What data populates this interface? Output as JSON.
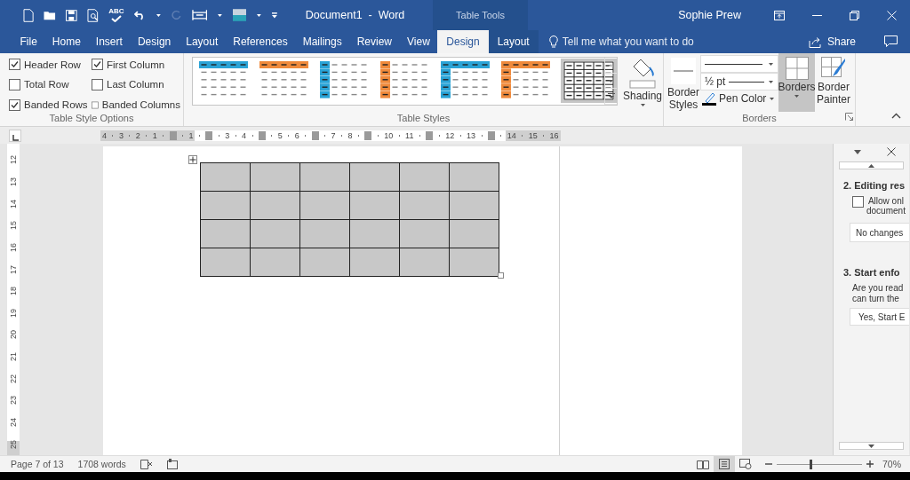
{
  "title_bar": {
    "spelling_icon_text": "ABC",
    "document_title": "Document1  -  Word",
    "contextual_label": "Table Tools",
    "user": "Sophie Prew"
  },
  "tabs": [
    {
      "label": "File",
      "selected": false,
      "contextual": false
    },
    {
      "label": "Home",
      "selected": false,
      "contextual": false
    },
    {
      "label": "Insert",
      "selected": false,
      "contextual": false
    },
    {
      "label": "Design",
      "selected": false,
      "contextual": false
    },
    {
      "label": "Layout",
      "selected": false,
      "contextual": false
    },
    {
      "label": "References",
      "selected": false,
      "contextual": false
    },
    {
      "label": "Mailings",
      "selected": false,
      "contextual": false
    },
    {
      "label": "Review",
      "selected": false,
      "contextual": false
    },
    {
      "label": "View",
      "selected": false,
      "contextual": false
    },
    {
      "label": "Design",
      "selected": true,
      "contextual": true
    },
    {
      "label": "Layout",
      "selected": false,
      "contextual": true
    }
  ],
  "tell_me": {
    "placeholder": "Tell me what you want to do"
  },
  "share": "Share",
  "ribbon": {
    "table_style_options": {
      "label": "Table Style Options",
      "options": [
        {
          "label": "Header Row",
          "checked": true
        },
        {
          "label": "First Column",
          "checked": true
        },
        {
          "label": "Total Row",
          "checked": false
        },
        {
          "label": "Last Column",
          "checked": false
        },
        {
          "label": "Banded Rows",
          "checked": true
        },
        {
          "label": "Banded Columns",
          "checked": false
        }
      ]
    },
    "table_styles": {
      "label": "Table Styles",
      "styles": [
        {
          "kind": "header_row",
          "color": "#2aa3d6",
          "selected": false
        },
        {
          "kind": "header_row",
          "color": "#ef8a3c",
          "selected": false
        },
        {
          "kind": "first_column",
          "color": "#2aa3d6",
          "selected": false
        },
        {
          "kind": "first_column",
          "color": "#ef8a3c",
          "selected": false
        },
        {
          "kind": "header_first",
          "color": "#2aa3d6",
          "selected": false
        },
        {
          "kind": "header_first",
          "color": "#ef8a3c",
          "selected": false
        },
        {
          "kind": "grid",
          "selected": true
        }
      ],
      "shading": "Shading"
    },
    "borders": {
      "label": "Borders",
      "border_styles": "Border Styles",
      "pen_weight": "½ pt",
      "pen_color": "Pen Color",
      "borders_button": {
        "label": "Borders",
        "pressed": true
      },
      "border_painter": "Border Painter"
    }
  },
  "ruler": {
    "horizontal": [
      {
        "kind": "label",
        "text": "4"
      },
      {
        "kind": "label",
        "text": "3"
      },
      {
        "kind": "label",
        "text": "2"
      },
      {
        "kind": "label",
        "text": "1"
      },
      {
        "kind": "marker"
      },
      {
        "kind": "label",
        "text": "1"
      },
      {
        "kind": "marker"
      },
      {
        "kind": "label",
        "text": "3"
      },
      {
        "kind": "label",
        "text": "4"
      },
      {
        "kind": "marker"
      },
      {
        "kind": "label",
        "text": "5"
      },
      {
        "kind": "label",
        "text": "6"
      },
      {
        "kind": "marker"
      },
      {
        "kind": "label",
        "text": "7"
      },
      {
        "kind": "label",
        "text": "8"
      },
      {
        "kind": "marker"
      },
      {
        "kind": "label",
        "text": "10"
      },
      {
        "kind": "label",
        "text": "11"
      },
      {
        "kind": "marker"
      },
      {
        "kind": "label",
        "text": "12"
      },
      {
        "kind": "label",
        "text": "13"
      },
      {
        "kind": "marker"
      },
      {
        "kind": "label",
        "text": "14"
      },
      {
        "kind": "label",
        "text": "15"
      },
      {
        "kind": "label",
        "text": "16"
      }
    ],
    "vertical": [
      "12",
      "13",
      "14",
      "15",
      "16",
      "17",
      "18",
      "19",
      "20",
      "21",
      "22",
      "23",
      "24",
      "25"
    ]
  },
  "document": {
    "table": {
      "rows": [
        {
          "cells": [
            {
              "shaded": true
            },
            {
              "shaded": true
            },
            {
              "shaded": true
            },
            {
              "shaded": true
            },
            {
              "shaded": true
            },
            {
              "shaded": true
            }
          ]
        },
        {
          "cells": [
            {
              "shaded": true
            },
            {
              "shaded": true
            },
            {
              "shaded": true
            },
            {
              "shaded": true
            },
            {
              "shaded": true
            },
            {
              "shaded": true
            }
          ]
        },
        {
          "cells": [
            {
              "shaded": true
            },
            {
              "shaded": true
            },
            {
              "shaded": true
            },
            {
              "shaded": true
            },
            {
              "shaded": true
            },
            {
              "shaded": true
            }
          ]
        },
        {
          "cells": [
            {
              "shaded": true
            },
            {
              "shaded": true
            },
            {
              "shaded": true
            },
            {
              "shaded": true
            },
            {
              "shaded": true
            },
            {
              "shaded": true
            }
          ]
        }
      ]
    }
  },
  "restrict_editing_pane": {
    "section_2_heading": "2. Editing res",
    "allow_only": {
      "lines": [
        "Allow onl",
        "document"
      ],
      "checked": false
    },
    "restriction_value": "No changes",
    "section_3_heading": "3. Start enfo",
    "question_lines": [
      "Are you read",
      "can turn the"
    ],
    "start_button": "Yes, Start E"
  },
  "status_bar": {
    "page": "Page 7 of 13",
    "words": "1708 words",
    "views": [
      {
        "kind": "read",
        "selected": false
      },
      {
        "kind": "print",
        "selected": true
      },
      {
        "kind": "web",
        "selected": false
      }
    ],
    "zoom": {
      "level": 0.4,
      "percent": "70%"
    }
  }
}
